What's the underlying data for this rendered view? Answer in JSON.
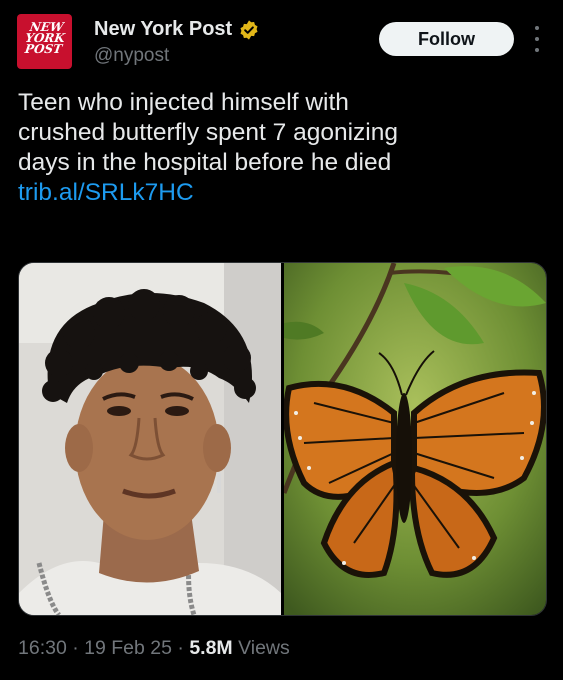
{
  "account": {
    "name": "New York Post",
    "handle": "@nypost",
    "logo_lines": [
      "NEW",
      "YORK",
      "POST"
    ]
  },
  "follow_label": "Follow",
  "tweet": {
    "lines": [
      "Teen who injected himself with",
      "crushed butterfly spent 7 agonizing",
      "days in the hospital before he died"
    ],
    "link": "trib.al/SRLk7HC"
  },
  "meta": {
    "time": "16:30",
    "sep1": " · ",
    "date": "19 Feb 25",
    "sep2": " · ",
    "views": "5.8M",
    "views_label": " Views"
  },
  "colors": {
    "background": "#000000",
    "text": "#e7e9ea",
    "secondary": "#71767b",
    "link": "#1d9bf0",
    "verified": "#e2b719",
    "brand": "#c8102e"
  }
}
